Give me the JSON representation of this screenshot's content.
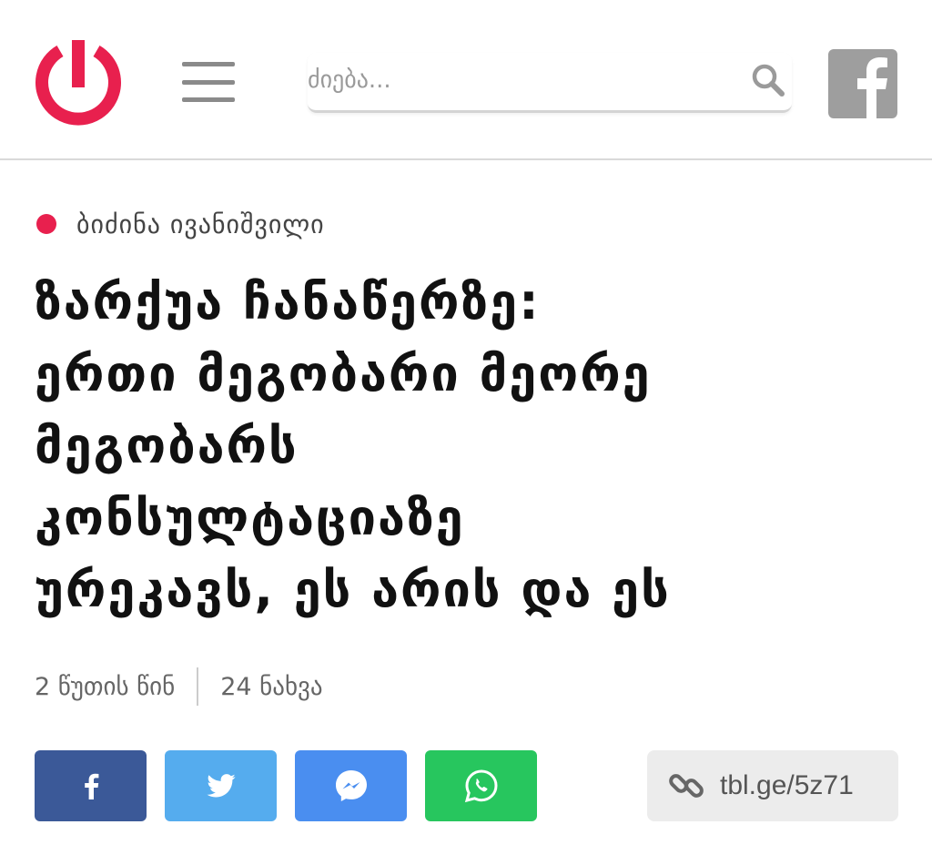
{
  "header": {
    "logo_icon": "power-icon",
    "menu_icon": "hamburger-icon",
    "search": {
      "placeholder": "ძიება...",
      "icon": "search-icon"
    },
    "social_icon": "facebook-icon"
  },
  "article": {
    "category": "ბიძინა ივანიშვილი",
    "headline_lines": [
      "ზარქუა ჩანაწერზე:",
      "ერთი მეგობარი მეორე",
      "მეგობარს",
      "კონსულტაციაზე",
      "ურეკავს, ეს არის და ეს"
    ],
    "meta": {
      "time": "2 წუთის წინ",
      "views": "24 ნახვა"
    }
  },
  "share": {
    "buttons": [
      {
        "name": "facebook",
        "icon": "facebook-icon",
        "color": "#3b5998"
      },
      {
        "name": "twitter",
        "icon": "twitter-icon",
        "color": "#55acee"
      },
      {
        "name": "messenger",
        "icon": "messenger-icon",
        "color": "#4a8ef0"
      },
      {
        "name": "whatsapp",
        "icon": "whatsapp-icon",
        "color": "#27c65e"
      }
    ],
    "short_link": "tbl.ge/5z71",
    "link_icon": "link-icon"
  },
  "colors": {
    "brand_red": "#e8204e",
    "text_dark": "#111111",
    "text_muted": "#666666",
    "divider": "#d9d9d9"
  }
}
